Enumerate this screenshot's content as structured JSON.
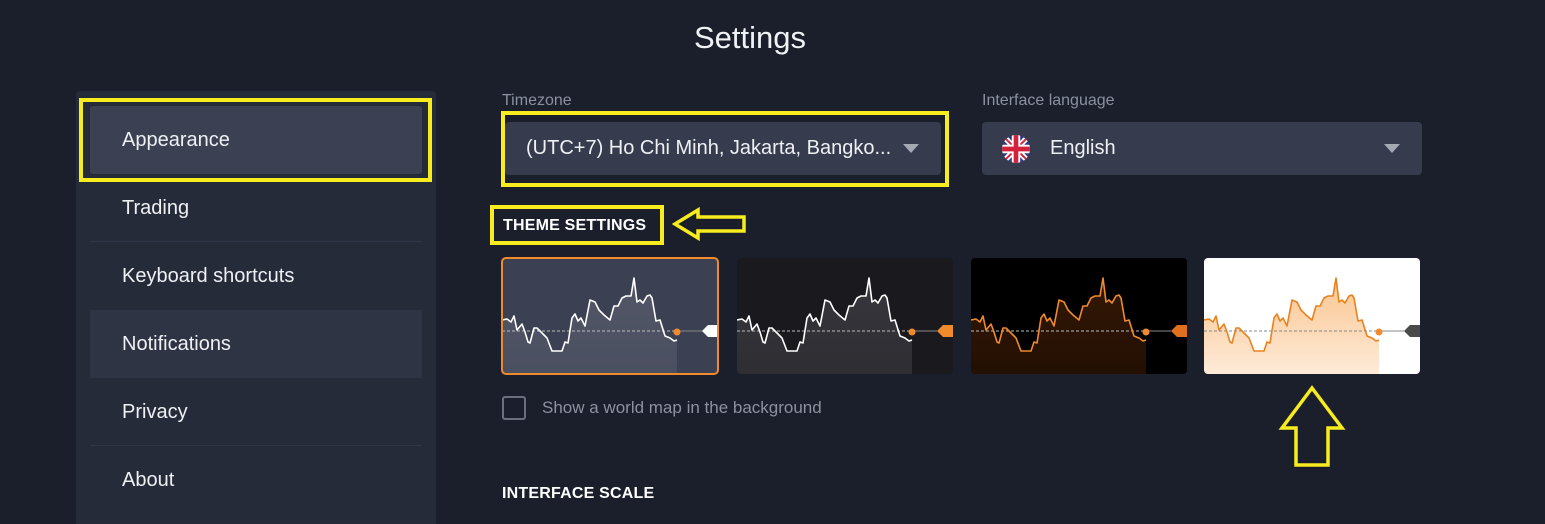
{
  "header": {
    "title": "Settings"
  },
  "sidebar": {
    "items": [
      {
        "label": "Appearance",
        "state": "active"
      },
      {
        "label": "Trading",
        "state": "normal"
      },
      {
        "label": "Keyboard shortcuts",
        "state": "normal"
      },
      {
        "label": "Notifications",
        "state": "hover"
      },
      {
        "label": "Privacy",
        "state": "normal"
      },
      {
        "label": "About",
        "state": "normal"
      }
    ]
  },
  "timezone": {
    "label": "Timezone",
    "value": "(UTC+7) Ho Chi Minh, Jakarta, Bangko...",
    "icon": "chevron-down-icon"
  },
  "language": {
    "label": "Interface language",
    "value": "English",
    "flag_icon": "uk-flag-icon",
    "icon": "chevron-down-icon"
  },
  "theme_settings": {
    "title": "THEME SETTINGS",
    "themes": [
      {
        "name": "grey",
        "selected": true,
        "bg": "#3b4152",
        "line": "#ffffff",
        "fill": "#55596a",
        "marker": "#ffffff",
        "dot": "#f08a2c"
      },
      {
        "name": "dark",
        "selected": false,
        "bg": "#1a1a1e",
        "line": "#ffffff",
        "fill": "#3a3a40",
        "marker": "#f08a2c",
        "dot": "#f08a2c"
      },
      {
        "name": "black",
        "selected": false,
        "bg": "#000000",
        "line": "#f08a2c",
        "fill": "#3a1a05",
        "marker": "#e07020",
        "dot": "#f08a2c"
      },
      {
        "name": "light",
        "selected": false,
        "bg": "#ffffff",
        "line": "#e8821e",
        "fill": "#fbc590",
        "marker": "#4a4a4a",
        "dot": "#f08a2c"
      }
    ]
  },
  "world_map": {
    "label": "Show a world map in the background",
    "checked": false
  },
  "interface_scale": {
    "title": "INTERFACE SCALE"
  },
  "colors": {
    "accent": "#f08a2c",
    "highlight": "#f7ec1d",
    "background": "#1b1f2b",
    "panel": "#262b3a"
  },
  "annotations": {
    "color": "#f7ec1d",
    "arrows": [
      "left-arrow-to-theme-settings",
      "up-arrow-to-light-theme"
    ]
  }
}
